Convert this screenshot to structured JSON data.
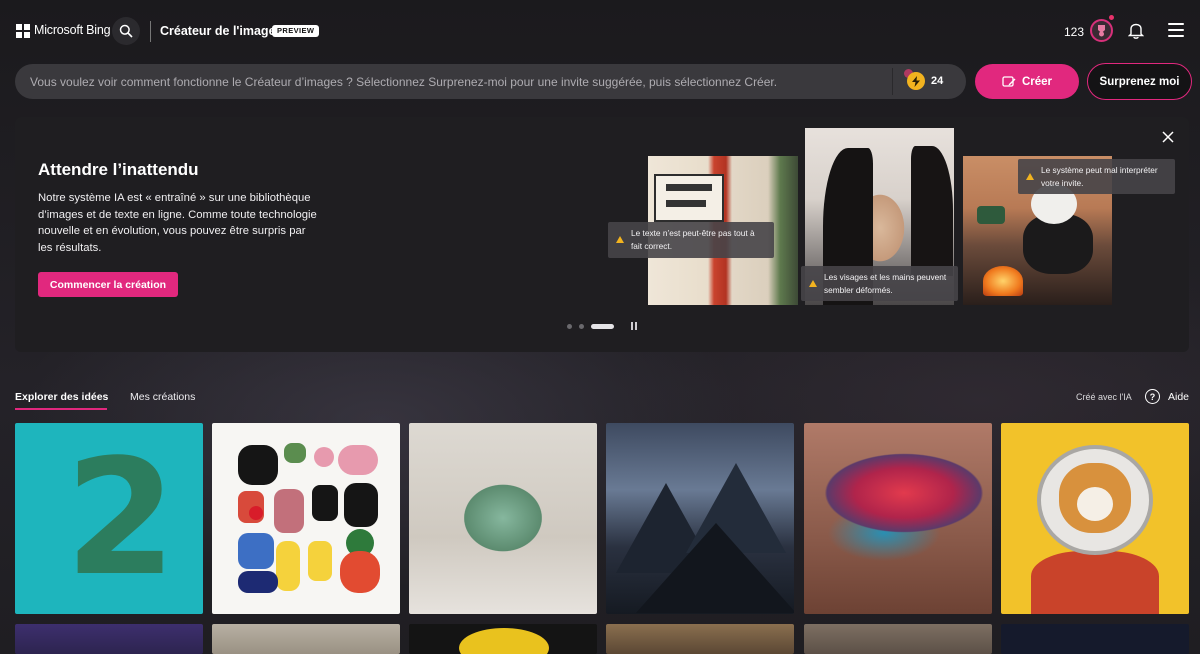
{
  "header": {
    "brand": "Microsoft Bing",
    "product_title": "Créateur de l'image",
    "preview_badge": "PREVIEW",
    "rewards_count": "123"
  },
  "prompt": {
    "placeholder": "Vous voulez voir comment fonctionne le Créateur d’images ? Sélectionnez Surprenez-moi pour une invite suggérée, puis sélectionnez Créer.",
    "boosts_count": "24",
    "create_label": "Créer",
    "surprise_label": "Surprenez moi"
  },
  "banner": {
    "title": "Attendre l’inattendu",
    "text": "Notre système IA est « entraîné » sur une bibliothèque d’images et de texte en ligne. Comme toute technologie nouvelle et en évolution, vous pouvez être surpris par les résultats.",
    "start_label": "Commencer la création",
    "notes": [
      "Le texte n’est peut-être pas tout à fait correct.",
      "Les visages et les mains peuvent sembler déformés.",
      "Le système peut mal interpréter votre invite."
    ],
    "slide_index": 3,
    "slide_count": 3
  },
  "tabs": {
    "explore": "Explorer des idées",
    "mine": "Mes créations",
    "ai_made": "Créé avec l'IA",
    "help": "Aide"
  },
  "icons": {
    "search": "search-icon",
    "rewards": "rewards-medal-icon",
    "bell": "bell-icon",
    "menu": "hamburger-menu-icon",
    "boost": "lightning-bolt-icon",
    "create": "image-edit-icon",
    "close": "close-icon",
    "pause": "pause-icon",
    "warning": "warning-icon",
    "help": "question-circle-icon"
  },
  "colors": {
    "accent": "#e1287e",
    "boost": "#f2b31f",
    "background": "#1c1b1f"
  }
}
